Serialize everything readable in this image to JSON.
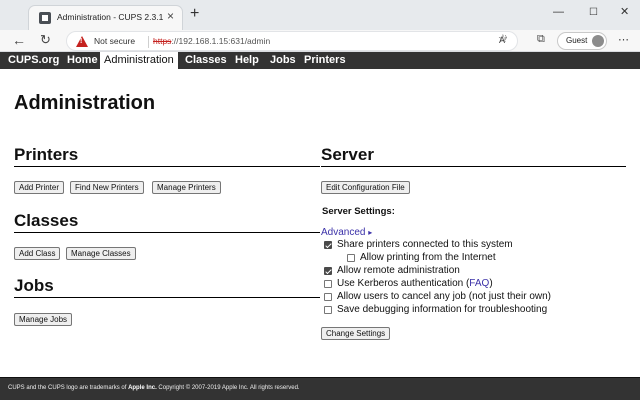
{
  "browser": {
    "tab_title": "Administration - CUPS 2.3.1",
    "tab_close": "×",
    "new_tab": "+",
    "not_secure": "Not secure",
    "url_scheme": "https",
    "url_rest": "://192.168.1.15:631/admin",
    "profile_label": "Guest",
    "icons": [
      "back-icon",
      "reload-icon",
      "warning-icon",
      "read-aloud-icon",
      "favorite-icon",
      "collections-icon",
      "more-icon"
    ]
  },
  "nav": {
    "items": [
      "CUPS.org",
      "Home",
      "Administration",
      "Classes",
      "Help",
      "Jobs",
      "Printers"
    ],
    "active": "Administration"
  },
  "page": {
    "title": "Administration",
    "printers": {
      "heading": "Printers",
      "buttons": [
        "Add Printer",
        "Find New Printers",
        "Manage Printers"
      ]
    },
    "classes": {
      "heading": "Classes",
      "buttons": [
        "Add Class",
        "Manage Classes"
      ]
    },
    "jobs": {
      "heading": "Jobs",
      "buttons": [
        "Manage Jobs"
      ]
    },
    "server": {
      "heading": "Server",
      "edit_button": "Edit Configuration File",
      "settings_label": "Server Settings:",
      "advanced_link": "Advanced",
      "advanced_arrow": "▸",
      "options": [
        {
          "label": "Share printers connected to this system",
          "checked": true
        },
        {
          "label": "Allow printing from the Internet",
          "checked": false
        },
        {
          "label": "Allow remote administration",
          "checked": true
        },
        {
          "label": "Use Kerberos authentication (",
          "link": "FAQ",
          "suffix": ")",
          "checked": false
        },
        {
          "label": "Allow users to cancel any job (not just their own)",
          "checked": false
        },
        {
          "label": "Save debugging information for troubleshooting",
          "checked": false
        }
      ],
      "change_button": "Change Settings"
    }
  },
  "footer": {
    "text_a": "CUPS and the CUPS logo are trademarks of ",
    "company": "Apple Inc.",
    "text_b": " Copyright © 2007-2019 Apple Inc. All rights reserved."
  }
}
